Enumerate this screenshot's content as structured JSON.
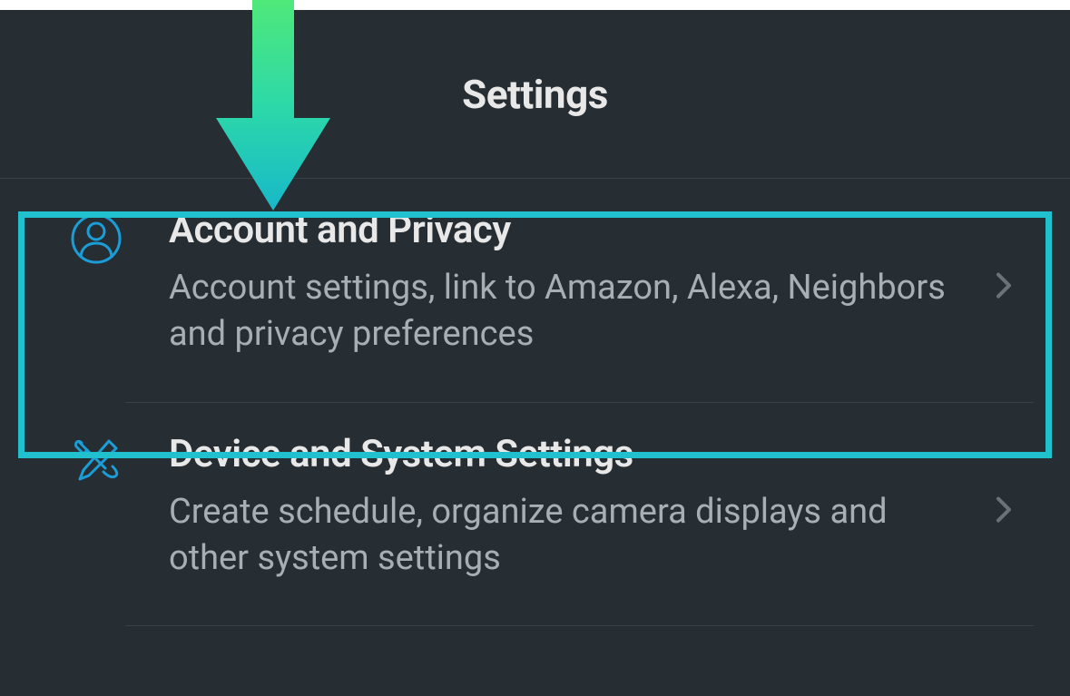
{
  "header": {
    "title": "Settings"
  },
  "items": [
    {
      "title": "Account and Privacy",
      "description": "Account settings, link to Amazon, Alexa, Neighbors and privacy preferences"
    },
    {
      "title": "Device and System Settings",
      "description": "Create schedule, organize camera displays and other system settings"
    }
  ]
}
